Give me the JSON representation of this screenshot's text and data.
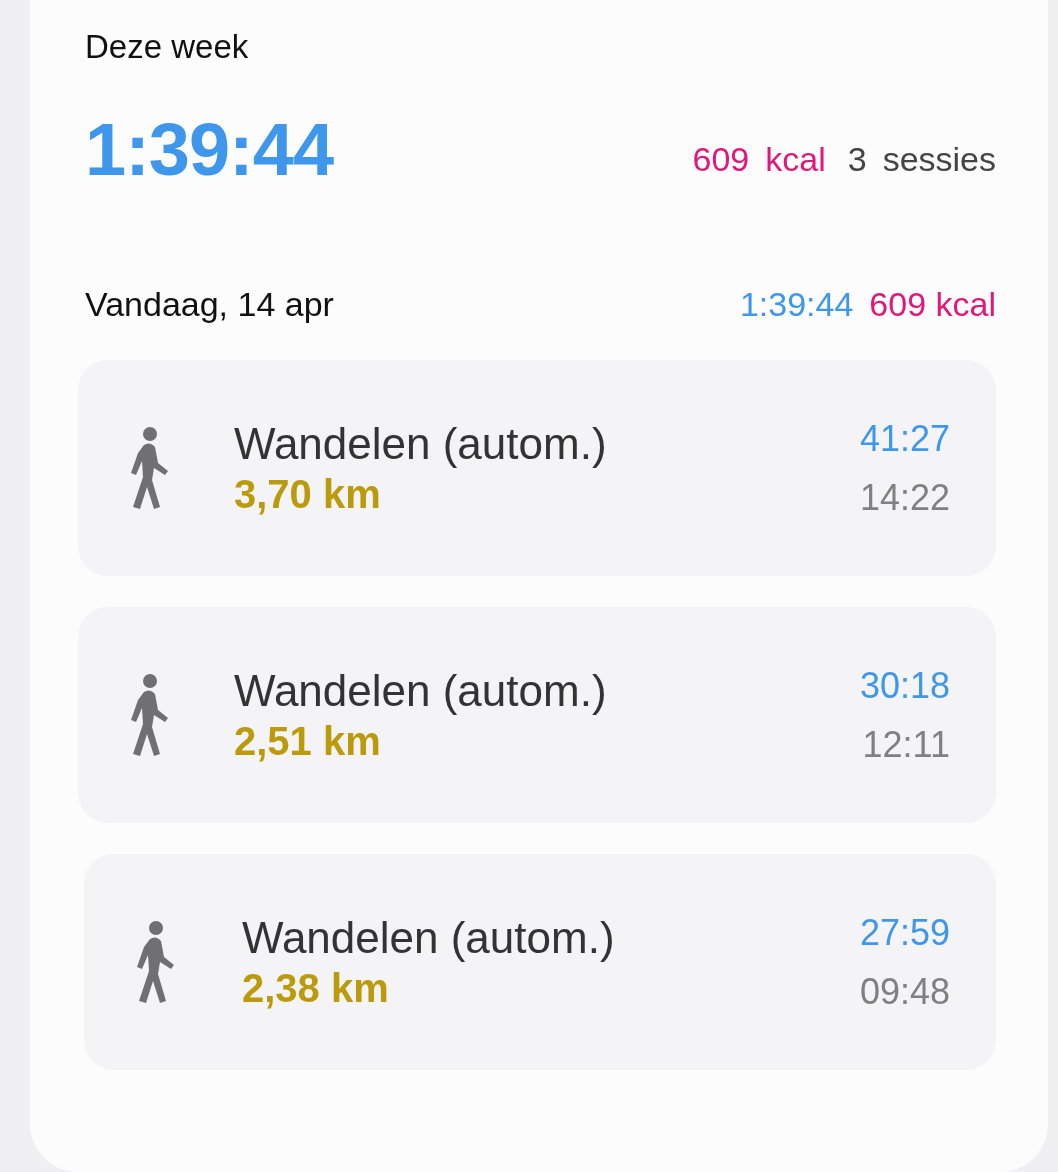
{
  "week": {
    "title": "Deze week",
    "duration": "1:39:44",
    "calories": "609",
    "calories_unit": "kcal",
    "sessions": "3",
    "sessions_unit": "sessies"
  },
  "day": {
    "title": "Vandaag, 14 apr",
    "duration": "1:39:44",
    "calories": "609 kcal"
  },
  "sessions": [
    {
      "kind": "walking",
      "name": "Wandelen (autom.)",
      "distance": "3,70 km",
      "duration": "41:27",
      "start": "14:22"
    },
    {
      "kind": "walking",
      "name": "Wandelen (autom.)",
      "distance": "2,51 km",
      "duration": "30:18",
      "start": "12:11"
    },
    {
      "kind": "walking",
      "name": "Wandelen (autom.)",
      "distance": "2,38 km",
      "duration": "27:59",
      "start": "09:48"
    }
  ]
}
